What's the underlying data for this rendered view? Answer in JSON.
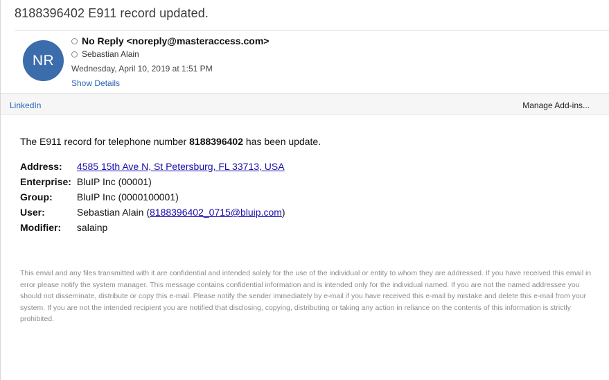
{
  "message": {
    "subject": "8188396402 E911 record updated.",
    "avatar_initials": "NR",
    "from": "No Reply <noreply@masteraccess.com>",
    "to": "Sebastian Alain",
    "date": "Wednesday, April 10, 2019 at 1:51 PM",
    "show_details": "Show Details"
  },
  "addin_bar": {
    "linkedin": "LinkedIn",
    "manage_addins": "Manage Add-ins..."
  },
  "body": {
    "intro_prefix": "The E911 record for telephone number ",
    "phone": "8188396402",
    "intro_suffix": " has been update.",
    "fields": {
      "address_label": "Address:",
      "address_value": "4585 15th Ave N, St Petersburg, FL 33713, USA",
      "enterprise_label": "Enterprise:",
      "enterprise_value": "BluIP Inc (00001)",
      "group_label": "Group:",
      "group_value": "BluIP Inc (0000100001)",
      "user_label": "User:",
      "user_name": "Sebastian Alain (",
      "user_email": "8188396402_0715@bluip.com",
      "user_close": ")",
      "modifier_label": "Modifier:",
      "modifier_value": "salainp"
    },
    "disclaimer": "This email and any files transmitted with it are confidential and intended solely for the use of the individual or entity to whom they are addressed. If you have received this email in error please notify the system manager. This message contains confidential information and is intended only for the individual named. If you are not the named addressee you should not disseminate, distribute or copy this e-mail. Please notify the sender immediately by e-mail if you have received this e-mail by mistake and delete this e-mail from your system. If you are not the intended recipient you are notified that disclosing, copying, distributing or taking any action in reliance on the contents of this information is strictly prohibited."
  },
  "colors": {
    "avatar_bg": "#3b6cab",
    "link_blue": "#2a64b8",
    "hyperlink": "#1a0dab"
  }
}
